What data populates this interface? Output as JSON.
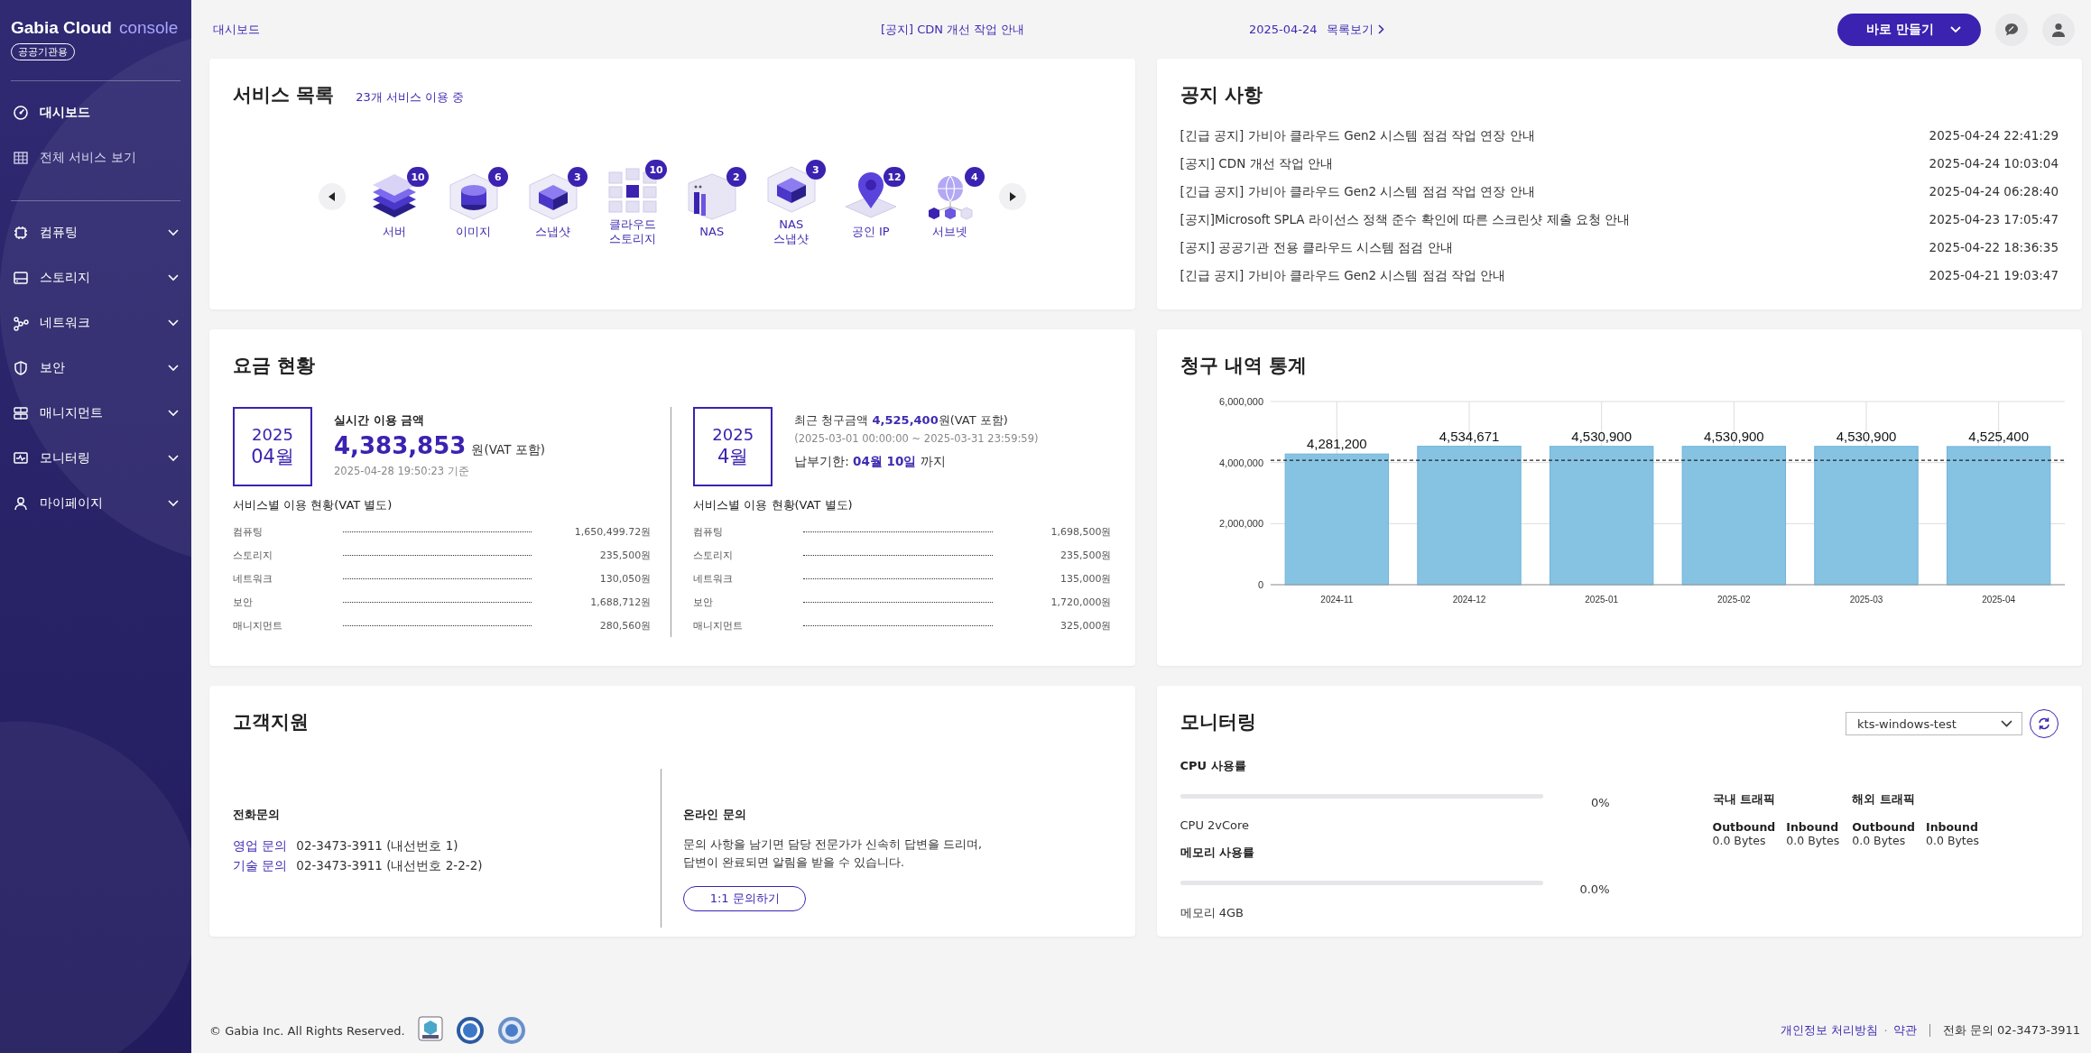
{
  "sidebar": {
    "brand": "Gabia Cloud",
    "product": "console",
    "badge": "공공기관용",
    "top_items": [
      {
        "label": "대시보드",
        "kind": "gauge",
        "selected": true
      },
      {
        "label": "전체 서비스 보기",
        "kind": "grid",
        "selected": false
      }
    ],
    "menu_items": [
      {
        "label": "컴퓨팅",
        "kind": "chip",
        "expanded": false
      },
      {
        "label": "스토리지",
        "kind": "drive",
        "expanded": false
      },
      {
        "label": "네트워크",
        "kind": "network",
        "expanded": false
      },
      {
        "label": "보안",
        "kind": "shield",
        "expanded": false
      },
      {
        "label": "매니지먼트",
        "kind": "rack",
        "expanded": false
      },
      {
        "label": "모니터링",
        "kind": "monitor",
        "expanded": false
      },
      {
        "label": "마이페이지",
        "kind": "user",
        "expanded": false
      }
    ]
  },
  "top_bar": {
    "breadcrumb": "대시보드",
    "notice": "[공지] CDN 개선 작업 안내",
    "notice_date": "2025-04-24",
    "list_link": "목록보기",
    "create_button": "바로 만들기"
  },
  "services": {
    "title": "서비스 목록",
    "summary": "23개 서비스 이용 중",
    "items": [
      {
        "label": "서버",
        "count": "10",
        "kind": "layers"
      },
      {
        "label": "이미지",
        "count": "6",
        "kind": "cylinder"
      },
      {
        "label": "스냅샷",
        "count": "3",
        "kind": "cube"
      },
      {
        "label": "클라우드 스토리지",
        "count": "10",
        "kind": "grid"
      },
      {
        "label": "NAS",
        "count": "2",
        "kind": "box"
      },
      {
        "label": "NAS 스냅샷",
        "count": "3",
        "kind": "cube"
      },
      {
        "label": "공인 IP",
        "count": "12",
        "kind": "pin"
      },
      {
        "label": "서브넷",
        "count": "4",
        "kind": "globe"
      }
    ]
  },
  "notices": {
    "title": "공지 사항",
    "items": [
      {
        "text": "[긴급 공지] 가비아 클라우드 Gen2 시스템 점검 작업 연장 안내",
        "date": "2025-04-24 22:41:29"
      },
      {
        "text": "[공지] CDN 개선 작업 안내",
        "date": "2025-04-24 10:03:04"
      },
      {
        "text": "[긴급 공지] 가비아 클라우드 Gen2 시스템 점검 작업 연장 안내",
        "date": "2025-04-24 06:28:40"
      },
      {
        "text": "[공지]Microsoft SPLA 라이선스 정책 준수 확인에 따른 스크린샷 제출 요청 안내",
        "date": "2025-04-23 17:05:47"
      },
      {
        "text": "[공지] 공공기관 전용 클라우드 시스템 점검 안내",
        "date": "2025-04-22 18:36:35"
      },
      {
        "text": "[긴급 공지] 가비아 클라우드 Gen2 시스템 점검 작업 안내",
        "date": "2025-04-21 19:03:47"
      }
    ]
  },
  "billing": {
    "title": "요금 현황",
    "current": {
      "year": "2025",
      "month": "04월",
      "label": "실시간 이용 금액",
      "amount": "4,383,853",
      "unit": "원(VAT 포함)",
      "timestamp": "2025-04-28 19:50:23 기준",
      "breakdown_title": "서비스별 이용 현황(VAT 별도)",
      "rows": [
        {
          "label": "컴퓨팅",
          "value": "1,650,499.72원"
        },
        {
          "label": "스토리지",
          "value": "235,500원"
        },
        {
          "label": "네트워크",
          "value": "130,050원"
        },
        {
          "label": "보안",
          "value": "1,688,712원"
        },
        {
          "label": "매니지먼트",
          "value": "280,560원"
        }
      ]
    },
    "recent": {
      "year": "2025",
      "month": "4월",
      "summary": "최근 청구금액 **4,525,400**원(VAT 포함)",
      "period": "(2025-03-01 00:00:00 ~ 2025-03-31 23:59:59)",
      "due": "납부기한: **04월 10일** 까지",
      "breakdown_title": "서비스별 이용 현황(VAT 별도)",
      "rows": [
        {
          "label": "컴퓨팅",
          "value": "1,698,500원"
        },
        {
          "label": "스토리지",
          "value": "235,500원"
        },
        {
          "label": "네트워크",
          "value": "135,000원"
        },
        {
          "label": "보안",
          "value": "1,720,000원"
        },
        {
          "label": "매니지먼트",
          "value": "325,000원"
        }
      ]
    }
  },
  "billing_stats": {
    "title": "청구 내역 통계",
    "chart_data": {
      "type": "bar",
      "categories": [
        "2024-11",
        "2024-12",
        "2025-01",
        "2025-02",
        "2025-03",
        "2025-04"
      ],
      "values": [
        4281200,
        4534671,
        4530900,
        4530900,
        4530900,
        4525400
      ],
      "grid": true,
      "ylim": [
        0,
        6000000
      ],
      "yticks": [
        {
          "value": 0,
          "label": "0"
        },
        {
          "value": 2000000,
          "label": "2,000,000"
        },
        {
          "value": 4000000,
          "label": "4,000,000"
        },
        {
          "value": 6000000,
          "label": "6,000,000"
        }
      ],
      "value_labels": [
        "4,281,200",
        "4,534,671",
        "4,530,900",
        "4,530,900",
        "4,530,900",
        "4,525,400"
      ]
    }
  },
  "support": {
    "title": "고객지원",
    "phone_title": "전화문의",
    "phones": [
      {
        "label": "영업 문의",
        "number": "02-3473-3911 (내선번호 1)"
      },
      {
        "label": "기술 문의",
        "number": "02-3473-3911 (내선번호 2-2-2)"
      }
    ],
    "online_title": "온라인 문의",
    "online_text": "문의 사항을 남기면 담당 전문가가 신속히 답변을 드리며,\n답변이 완료되면 알림을 받을 수 있습니다.",
    "online_button": "1:1 문의하기"
  },
  "monitoring": {
    "title": "모니터링",
    "instance": "kts-windows-test",
    "meters": [
      {
        "title": "CPU 사용률",
        "level": 0,
        "reading": "0%",
        "spec": "CPU 2vCore"
      },
      {
        "title": "메모리 사용률",
        "level": 0,
        "reading": "0.0%",
        "spec": "메모리 4GB"
      }
    ],
    "traffic": [
      {
        "title": "국내 트래픽",
        "columns": [
          {
            "label": "Outbound",
            "value": "0.0 Bytes"
          },
          {
            "label": "Inbound",
            "value": "0.0 Bytes"
          }
        ]
      },
      {
        "title": "해외 트래픽",
        "columns": [
          {
            "label": "Outbound",
            "value": "0.0 Bytes"
          },
          {
            "label": "Inbound",
            "value": "0.0 Bytes"
          }
        ]
      }
    ]
  },
  "footer": {
    "copyright": "© Gabia Inc. All Rights Reserved.",
    "privacy_link": "개인정보 처리방침",
    "separator": "·",
    "terms_link": "약관",
    "phone": "전화 문의 02-3473-3911"
  }
}
